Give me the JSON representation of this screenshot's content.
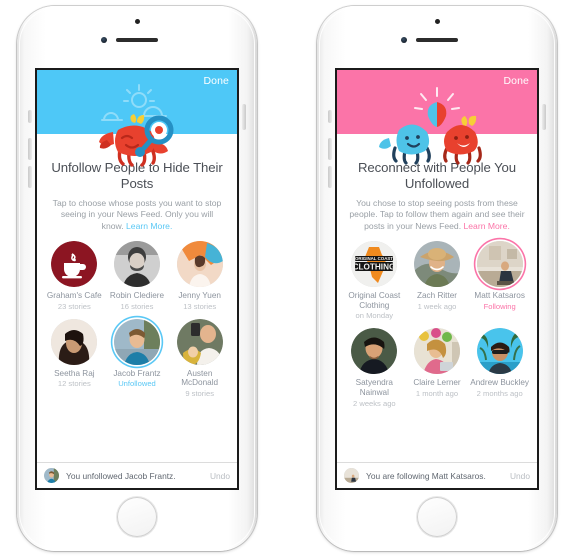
{
  "colors": {
    "hero_blue": "#4ec8f7",
    "hero_pink": "#fb74a8",
    "link_blue": "#5ac8f5",
    "link_pink": "#fb74a8",
    "title_gray": "#4b4f56",
    "body_gray": "#9aa0a6"
  },
  "phones": [
    {
      "id": "unfollow",
      "hero_color": "#4ec8f7",
      "done_label": "Done",
      "illustration": "crab-with-magnifying-glass",
      "title": "Unfollow People to Hide Their Posts",
      "subtitle": "Tap to choose whose posts you want to stop seeing in your News Feed. Only you will know.",
      "learn_more": "Learn More.",
      "people": [
        {
          "name": "Graham's Cafe",
          "meta": "23 stories",
          "state": "none",
          "avatar": "coffee-logo"
        },
        {
          "name": "Robin Clediere",
          "meta": "16 stories",
          "state": "none",
          "avatar": "man-bw"
        },
        {
          "name": "Jenny Yuen",
          "meta": "13 stories",
          "state": "none",
          "avatar": "woman-dance"
        },
        {
          "name": "Seetha Raj",
          "meta": "12 stories",
          "state": "none",
          "avatar": "woman-dark-hair"
        },
        {
          "name": "Jacob Frantz",
          "meta": "Unfollowed",
          "state": "blue",
          "avatar": "man-blue-shirt"
        },
        {
          "name": "Austen McDonald",
          "meta": "9 stories",
          "state": "none",
          "avatar": "man-baby"
        }
      ],
      "toast": {
        "message": "You unfollowed Jacob Frantz.",
        "undo": "Undo",
        "avatar": "man-blue-shirt"
      }
    },
    {
      "id": "reconnect",
      "hero_color": "#fb74a8",
      "done_label": "Done",
      "illustration": "two-crabs-fist-bump",
      "title": "Reconnect with People You Unfollowed",
      "subtitle": "You chose to stop seeing posts from these people. Tap to follow them again and see their posts in your News Feed.",
      "learn_more": "Learn More.",
      "people": [
        {
          "name": "Original Coast Clothing",
          "meta": "on Monday",
          "state": "none",
          "avatar": "coast-clothing-logo"
        },
        {
          "name": "Zach Ritter",
          "meta": "1 week ago",
          "state": "none",
          "avatar": "man-hat"
        },
        {
          "name": "Matt Katsaros",
          "meta": "Following",
          "state": "pink",
          "avatar": "man-studio"
        },
        {
          "name": "Satyendra Nainwal",
          "meta": "2 weeks ago",
          "state": "none",
          "avatar": "man-dark-shirt"
        },
        {
          "name": "Claire Lerner",
          "meta": "1 month ago",
          "state": "none",
          "avatar": "woman-shop"
        },
        {
          "name": "Andrew Buckley",
          "meta": "2 months ago",
          "state": "none",
          "avatar": "man-palms"
        }
      ],
      "toast": {
        "message": "You are following Matt Katsaros.",
        "undo": "Undo",
        "avatar": "man-studio"
      }
    }
  ]
}
